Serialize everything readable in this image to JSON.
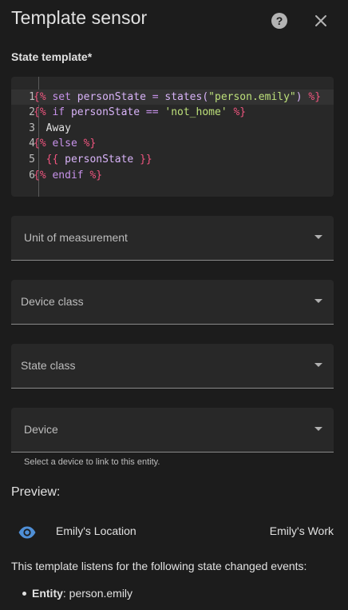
{
  "dialog": {
    "title": "Template sensor"
  },
  "icons": {
    "help": "help-circle-icon",
    "close": "close-icon",
    "preview": "eye-icon"
  },
  "state_template": {
    "label": "State template*",
    "lines": [
      {
        "num": "1",
        "tokens": [
          {
            "t": "{%",
            "c": "delim"
          },
          {
            "t": " set ",
            "c": "kw"
          },
          {
            "t": "personState",
            "c": "var"
          },
          {
            "t": " = ",
            "c": "op"
          },
          {
            "t": "states(",
            "c": "var"
          },
          {
            "t": "\"person.emily\"",
            "c": "str"
          },
          {
            "t": ") ",
            "c": "var"
          },
          {
            "t": "%}",
            "c": "delim"
          }
        ]
      },
      {
        "num": "2",
        "tokens": [
          {
            "t": "{%",
            "c": "delim"
          },
          {
            "t": " if ",
            "c": "kw"
          },
          {
            "t": "personState",
            "c": "var"
          },
          {
            "t": " == ",
            "c": "op"
          },
          {
            "t": "'not_home'",
            "c": "str"
          },
          {
            "t": " ",
            "c": "text"
          },
          {
            "t": "%}",
            "c": "delim"
          }
        ]
      },
      {
        "num": "3",
        "tokens": [
          {
            "t": "  Away",
            "c": "text"
          }
        ]
      },
      {
        "num": "4",
        "tokens": [
          {
            "t": "{%",
            "c": "delim"
          },
          {
            "t": " else ",
            "c": "kw"
          },
          {
            "t": "%}",
            "c": "delim"
          }
        ]
      },
      {
        "num": "5",
        "tokens": [
          {
            "t": "  {{",
            "c": "delim"
          },
          {
            "t": " personState ",
            "c": "var"
          },
          {
            "t": "}}",
            "c": "delim"
          }
        ]
      },
      {
        "num": "6",
        "tokens": [
          {
            "t": "{%",
            "c": "delim"
          },
          {
            "t": " endif ",
            "c": "kw"
          },
          {
            "t": "%}",
            "c": "delim"
          }
        ]
      }
    ]
  },
  "fields": {
    "unit": "Unit of measurement",
    "device_class": "Device class",
    "state_class": "State class",
    "device": "Device",
    "device_helper": "Select a device to link to this entity."
  },
  "preview": {
    "label": "Preview:",
    "entity_name": "Emily's Location",
    "entity_state": "Emily's Work",
    "listens_text": "This template listens for the following state changed events:",
    "listen_key": "Entity",
    "listen_value": ": person.emily"
  },
  "colors": {
    "background": "#1c1c1c",
    "field_background": "#282828",
    "accent_icon": "#4f8fd6",
    "jinja_delimiter": "#f0557f",
    "jinja_keyword": "#c792ea",
    "string": "#bde07a"
  }
}
